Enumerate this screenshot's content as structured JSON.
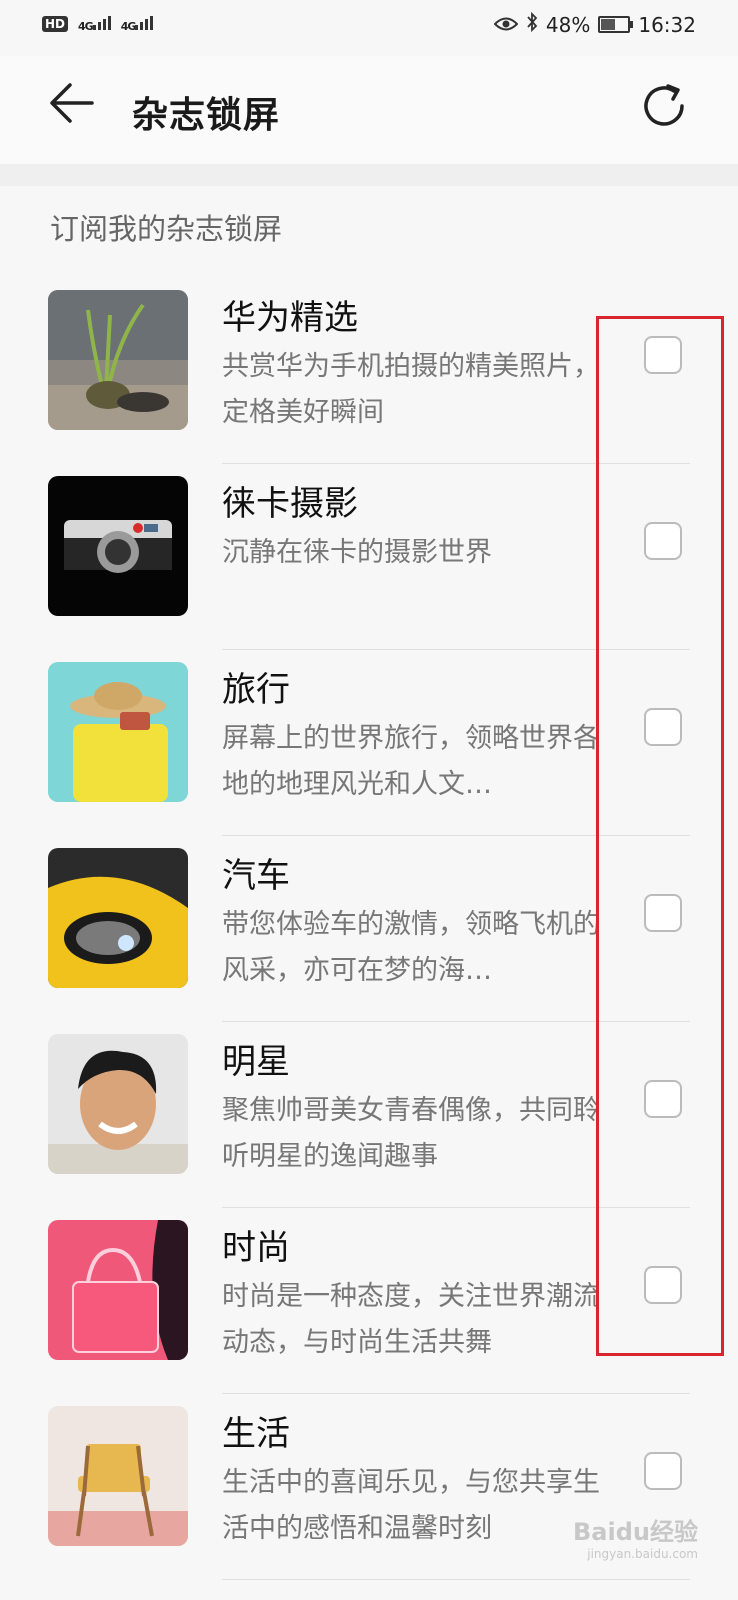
{
  "status_bar": {
    "hd": "HD",
    "sim1": "4G",
    "sim2": "4G",
    "battery_percent": "48%",
    "time": "16:32"
  },
  "header": {
    "title": "杂志锁屏"
  },
  "section_title": "订阅我的杂志锁屏",
  "items": [
    {
      "name": "华为精选",
      "desc": "共赏华为手机拍摄的精美照片，定格美好瞬间",
      "checked": false
    },
    {
      "name": "徕卡摄影",
      "desc": "沉静在徕卡的摄影世界",
      "checked": false
    },
    {
      "name": "旅行",
      "desc": "屏幕上的世界旅行，领略世界各地的地理风光和人文…",
      "checked": false
    },
    {
      "name": "汽车",
      "desc": "带您体验车的激情，领略飞机的风采，亦可在梦的海…",
      "checked": false
    },
    {
      "name": "明星",
      "desc": "聚焦帅哥美女青春偶像，共同聆听明星的逸闻趣事",
      "checked": false
    },
    {
      "name": "时尚",
      "desc": "时尚是一种态度，关注世界潮流动态，与时尚生活共舞",
      "checked": false
    },
    {
      "name": "生活",
      "desc": "生活中的喜闻乐见，与您共享生活中的感悟和温馨时刻",
      "checked": false
    }
  ],
  "watermark": {
    "brand": "Baidu经验",
    "url": "jingyan.baidu.com"
  },
  "colors": {
    "highlight": "#d9262e",
    "background": "#f7f7f7"
  }
}
